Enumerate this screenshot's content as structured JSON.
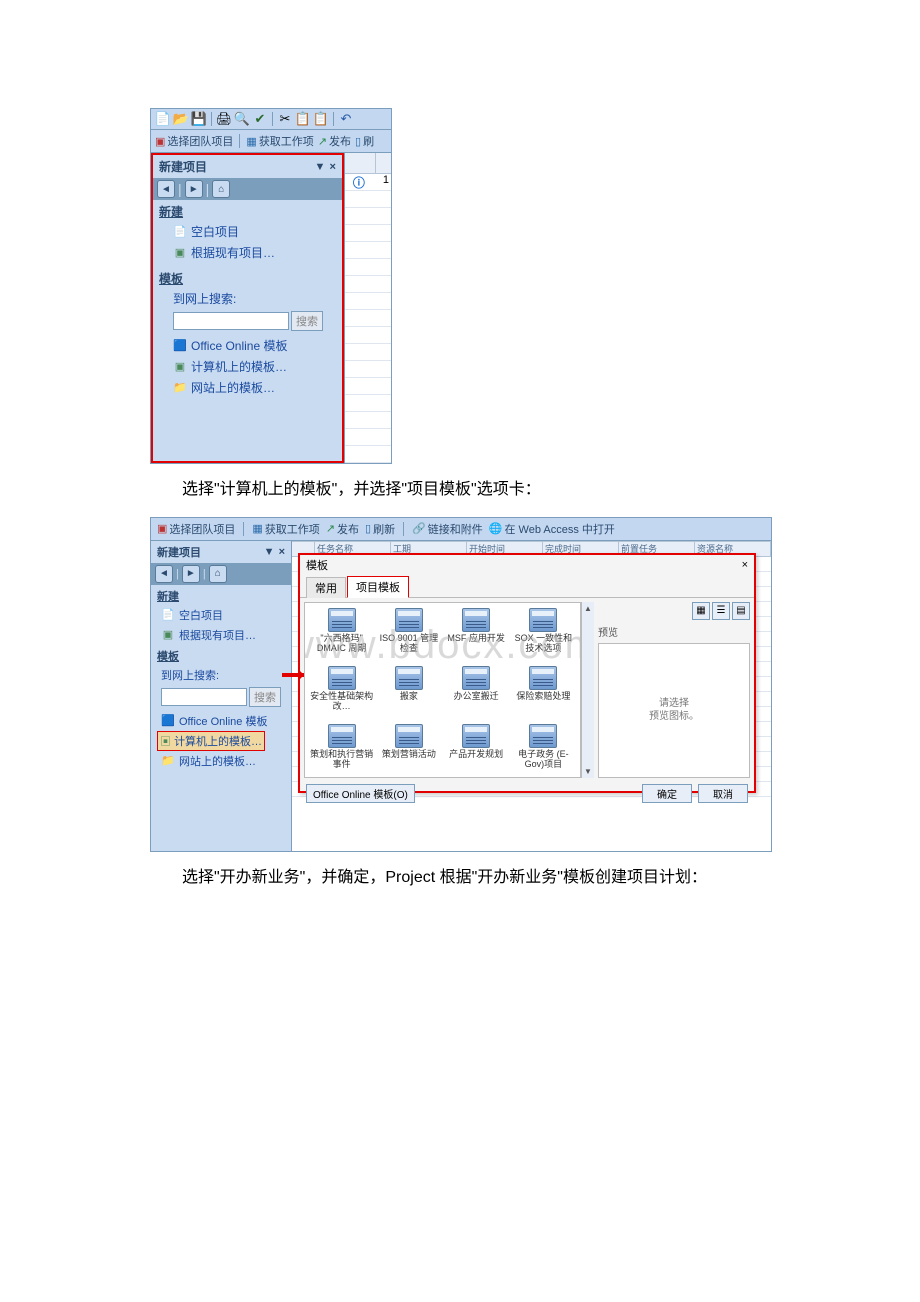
{
  "screenshot1": {
    "toolbar2": {
      "selectTeam": "选择团队项目",
      "getWork": "获取工作项",
      "publish": "发布",
      "refresh": "刷"
    },
    "panel": {
      "title": "新建项目",
      "section_new": "新建",
      "item_blank": "空白项目",
      "item_fromExisting": "根据现有项目…",
      "section_templates": "模板",
      "search_label": "到网上搜索:",
      "search_button": "搜索",
      "item_officeOnline": "Office Online 模板",
      "item_computer": "计算机上的模板…",
      "item_website": "网站上的模板…"
    },
    "grid_col1": "1"
  },
  "para1": "选择\"计算机上的模板\"，并选择\"项目模板\"选项卡：",
  "screenshot2": {
    "toolbar": {
      "selectTeam": "选择团队项目",
      "getWork": "获取工作项",
      "publish": "发布",
      "refresh": "刷新",
      "linksAttach": "链接和附件",
      "openWeb": "在 Web Access 中打开"
    },
    "panel": {
      "title": "新建项目",
      "section_new": "新建",
      "item_blank": "空白项目",
      "item_fromExisting": "根据现有项目…",
      "section_templates": "模板",
      "search_label": "到网上搜索:",
      "search_button": "搜索",
      "item_officeOnline": "Office Online 模板",
      "item_computer": "计算机上的模板…",
      "item_website": "网站上的模板…"
    },
    "grid_headers": [
      "",
      "任务名称",
      "工期",
      "开始时间",
      "完成时间",
      "前置任务",
      "资源名称"
    ],
    "dialog": {
      "title": "模板",
      "tab1": "常用",
      "tab2": "项目模板",
      "templates": [
        "\"六西格玛\" DMAIC 周期",
        "ISO 9001 管理检查",
        "MSF 应用开发",
        "SOX 一致性和技术选项",
        "安全性基础架构改…",
        "搬家",
        "办公室搬迁",
        "保险索赔处理",
        "策划和执行营销事件",
        "策划营销活动",
        "产品开发规划",
        "电子政务 (E-Gov)项目"
      ],
      "preview_label": "预览",
      "preview_text": "请选择\n预览图标。",
      "office_btn": "Office Online 模板(O)",
      "ok": "确定",
      "cancel": "取消"
    }
  },
  "para2": "选择\"开办新业务\"，并确定，Project 根据\"开办新业务\"模板创建项目计划：",
  "watermark": "www.bdocx.com"
}
